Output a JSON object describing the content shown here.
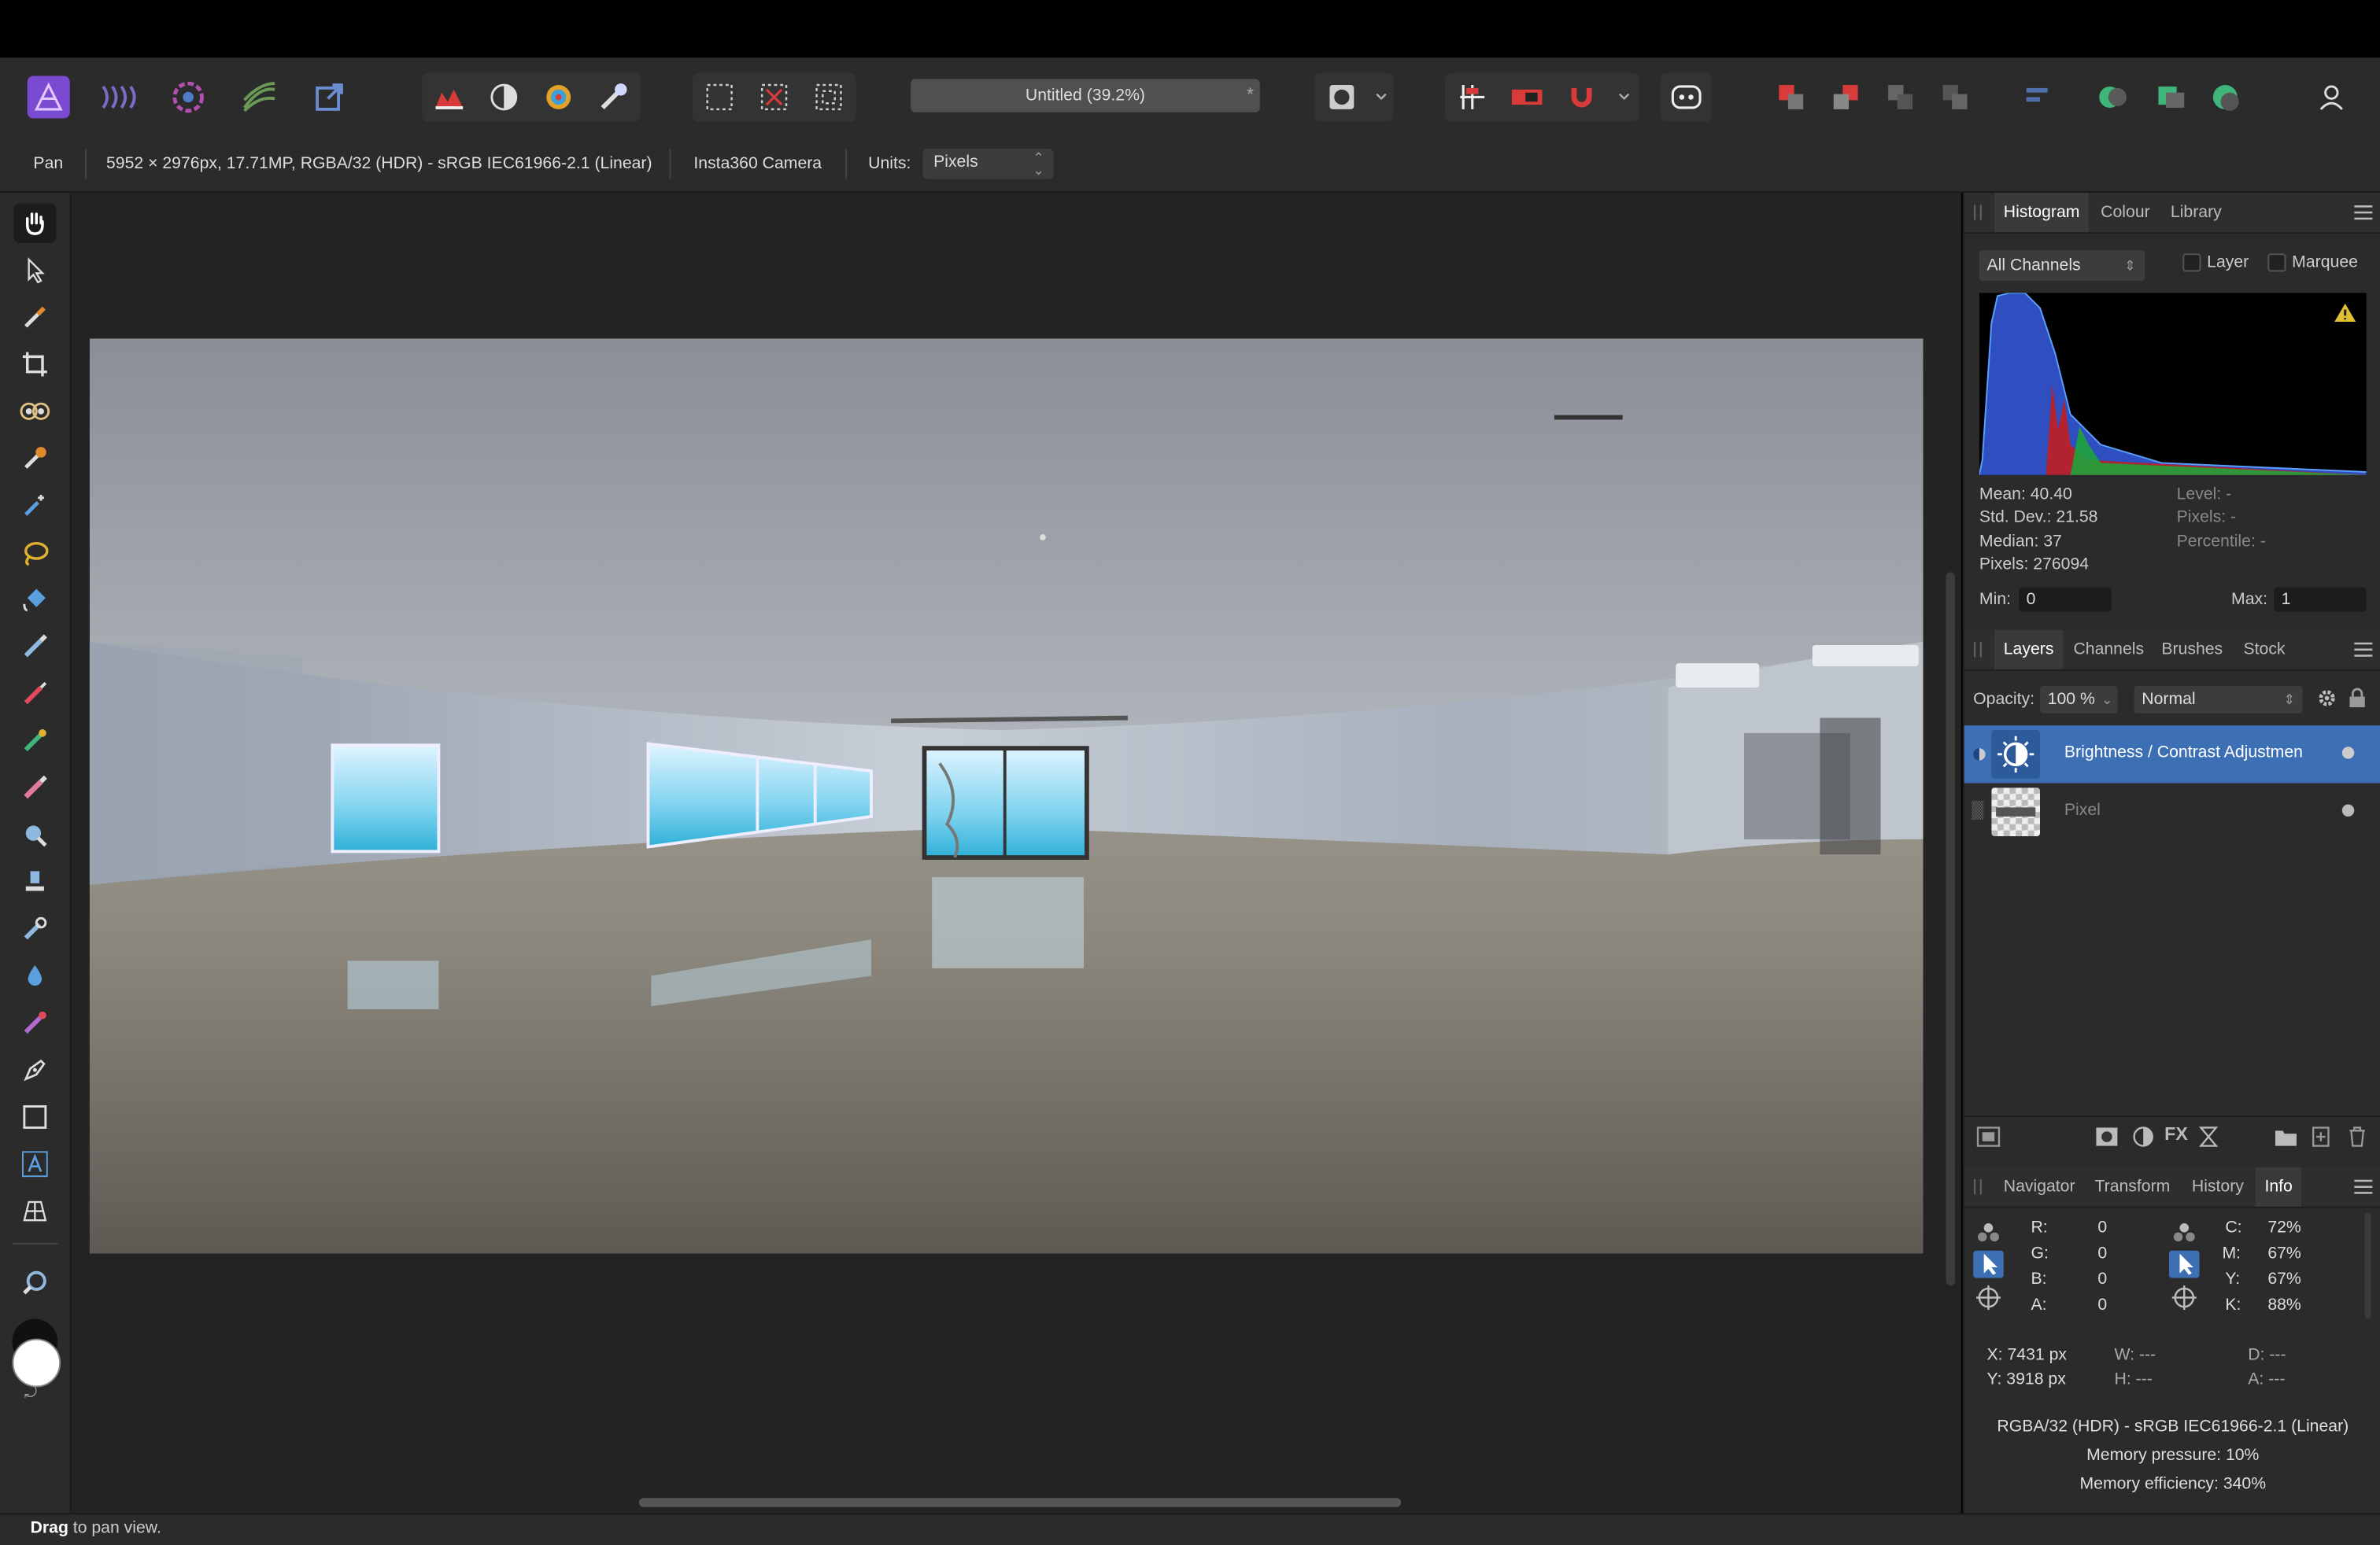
{
  "toolbar": {
    "document_title": "Untitled (39.2%)",
    "document_modified_mark": "*",
    "personas": [
      "photo-persona",
      "liquify-persona",
      "develop-persona",
      "tone-mapping-persona",
      "export-persona"
    ],
    "colors": {
      "accent": "#3d6fb5",
      "persona_purple": "#7a4bd0",
      "red": "#d93b3b"
    }
  },
  "context": {
    "tool_name": "Pan",
    "document_info": "5952 × 2976px, 17.71MP, RGBA/32 (HDR) - sRGB IEC61966-2.1 (Linear)",
    "camera": "Insta360 Camera",
    "units_label": "Units:",
    "units_value": "Pixels"
  },
  "tools": [
    "hand-tool",
    "move-tool",
    "color-picker-tool",
    "crop-tool",
    "red-eye-tool",
    "selection-brush-tool",
    "flood-select-tool",
    "freehand-selection-tool",
    "fill-tool",
    "paint-brush-tool",
    "pixel-tool",
    "paint-mixer-tool",
    "erase-brush-tool",
    "dodge-tool",
    "clone-brush-tool",
    "smudge-tool",
    "blur-tool",
    "median-brush-tool",
    "pen-tool",
    "rectangle-tool",
    "text-tool",
    "mesh-warp-tool",
    "zoom-tool"
  ],
  "histogram": {
    "tabs": [
      "Histogram",
      "Colour",
      "Library"
    ],
    "active_tab": "Histogram",
    "channel": "All Channels",
    "layer_label": "Layer",
    "marquee_label": "Marquee",
    "mean": "Mean: 40.40",
    "std_dev": "Std. Dev.: 21.58",
    "median": "Median: 37",
    "pixels": "Pixels: 276094",
    "level": "Level: -",
    "pixels_right": "Pixels: -",
    "percentile": "Percentile: -",
    "min_label": "Min:",
    "min_value": "0",
    "max_label": "Max:",
    "max_value": "1"
  },
  "layers": {
    "tabs": [
      "Layers",
      "Channels",
      "Brushes",
      "Stock"
    ],
    "active_tab": "Layers",
    "opacity_label": "Opacity:",
    "opacity_value": "100 %",
    "blend_mode": "Normal",
    "items": [
      {
        "name": "Brightness / Contrast Adjustmen",
        "selected": true
      },
      {
        "name": "Pixel",
        "selected": false
      }
    ]
  },
  "info": {
    "tabs": [
      "Navigator",
      "Transform",
      "History",
      "Info"
    ],
    "active_tab": "Info",
    "rgba": [
      {
        "label": "R:",
        "value": "0"
      },
      {
        "label": "G:",
        "value": "0"
      },
      {
        "label": "B:",
        "value": "0"
      },
      {
        "label": "A:",
        "value": "0"
      }
    ],
    "cmyk": [
      {
        "label": "C:",
        "value": "72%"
      },
      {
        "label": "M:",
        "value": "67%"
      },
      {
        "label": "Y:",
        "value": "67%"
      },
      {
        "label": "K:",
        "value": "88%"
      }
    ],
    "x": "X: 7431 px",
    "y": "Y: 3918 px",
    "w": "W: ---",
    "h": "H: ---",
    "d": "D: ---",
    "a": "A: ---",
    "color_format": "RGBA/32 (HDR) - sRGB IEC61966-2.1 (Linear)",
    "memory_pressure": "Memory pressure: 10%",
    "memory_efficiency": "Memory efficiency: 340%"
  },
  "status": {
    "bold": "Drag",
    "text": " to pan view."
  }
}
